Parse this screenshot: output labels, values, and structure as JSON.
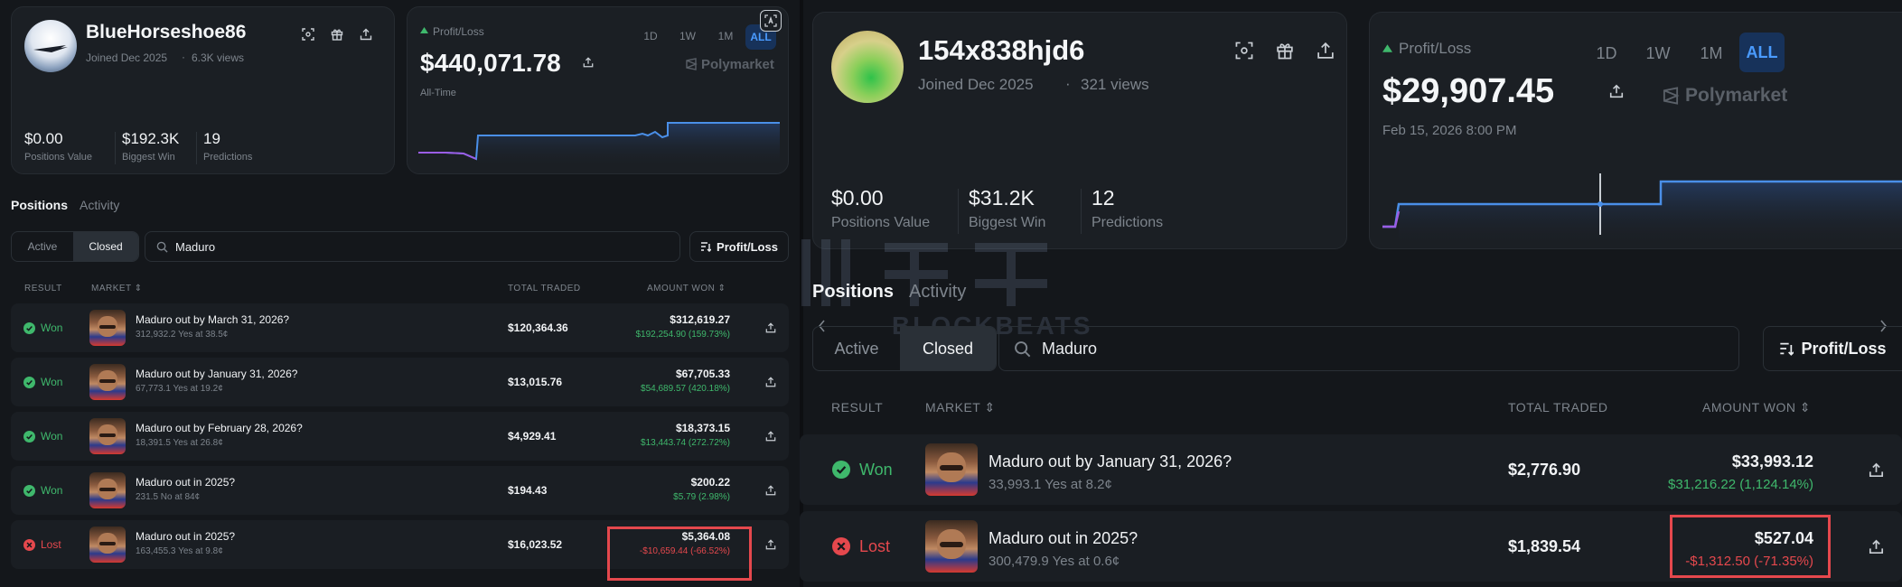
{
  "left": {
    "profile": {
      "username": "BlueHorseshoe86",
      "joined": "Joined Dec 2025",
      "views": "6.3K views",
      "stats": [
        {
          "value": "$0.00",
          "label": "Positions Value"
        },
        {
          "value": "$192.3K",
          "label": "Biggest Win"
        },
        {
          "value": "19",
          "label": "Predictions"
        }
      ]
    },
    "pnl": {
      "label": "Profit/Loss",
      "value": "$440,071.78",
      "sub": "All-Time",
      "brand": "Polymarket",
      "ranges": [
        "1D",
        "1W",
        "1M",
        "ALL"
      ],
      "active_range": "ALL"
    },
    "tabs": [
      "Positions",
      "Activity"
    ],
    "filter": {
      "active": "Active",
      "closed": "Closed"
    },
    "search": {
      "value": "Maduro"
    },
    "sort_label": "Profit/Loss",
    "columns": {
      "result": "RESULT",
      "market": "MARKET",
      "total_traded": "TOTAL TRADED",
      "amount_won": "AMOUNT WON"
    },
    "rows": [
      {
        "result": "Won",
        "market": "Maduro out by March 31, 2026?",
        "detail": "312,932.2 Yes at 38.5¢",
        "total": "$120,364.36",
        "amount": "$312,619.27",
        "pnl": "$192,254.90 (159.73%)"
      },
      {
        "result": "Won",
        "market": "Maduro out by January 31, 2026?",
        "detail": "67,773.1 Yes at 19.2¢",
        "total": "$13,015.76",
        "amount": "$67,705.33",
        "pnl": "$54,689.57 (420.18%)"
      },
      {
        "result": "Won",
        "market": "Maduro out by February 28, 2026?",
        "detail": "18,391.5 Yes at 26.8¢",
        "total": "$4,929.41",
        "amount": "$18,373.15",
        "pnl": "$13,443.74 (272.72%)"
      },
      {
        "result": "Won",
        "market": "Maduro out in 2025?",
        "detail": "231.5 No at 84¢",
        "total": "$194.43",
        "amount": "$200.22",
        "pnl": "$5.79 (2.98%)"
      },
      {
        "result": "Lost",
        "market": "Maduro out in 2025?",
        "detail": "163,455.3 Yes at 9.8¢",
        "total": "$16,023.52",
        "amount": "$5,364.08",
        "pnl": "-$10,659.44 (-66.52%)"
      }
    ]
  },
  "right": {
    "profile": {
      "username": "154x838hjd6",
      "joined": "Joined Dec 2025",
      "views": "321 views",
      "stats": [
        {
          "value": "$0.00",
          "label": "Positions Value"
        },
        {
          "value": "$31.2K",
          "label": "Biggest Win"
        },
        {
          "value": "12",
          "label": "Predictions"
        }
      ]
    },
    "pnl": {
      "label": "Profit/Loss",
      "value": "$29,907.45",
      "sub": "Feb 15, 2026 8:00 PM",
      "brand": "Polymarket",
      "ranges": [
        "1D",
        "1W",
        "1M",
        "ALL"
      ],
      "active_range": "ALL"
    },
    "tabs": [
      "Positions",
      "Activity"
    ],
    "filter": {
      "active": "Active",
      "closed": "Closed"
    },
    "search": {
      "value": "Maduro"
    },
    "sort_label": "Profit/Loss",
    "columns": {
      "result": "RESULT",
      "market": "MARKET",
      "total_traded": "TOTAL TRADED",
      "amount_won": "AMOUNT WON"
    },
    "rows": [
      {
        "result": "Won",
        "market": "Maduro out by January 31, 2026?",
        "detail": "33,993.1 Yes at 8.2¢",
        "total": "$2,776.90",
        "amount": "$33,993.12",
        "pnl": "$31,216.22 (1,124.14%)"
      },
      {
        "result": "Lost",
        "market": "Maduro out in 2025?",
        "detail": "300,479.9 Yes at 0.6¢",
        "total": "$1,839.54",
        "amount": "$527.04",
        "pnl": "-$1,312.50 (-71.35%)"
      }
    ]
  },
  "watermark": {
    "text": "BLOCKBEATS"
  },
  "colors": {
    "won": "#3fb86c",
    "lost": "#e5484d",
    "accent": "#4a9bff",
    "highlight_box": "#e5484d"
  },
  "icons": [
    "scan-icon",
    "gift-icon",
    "share-icon",
    "polymarket-logo-icon",
    "sort-icon",
    "search-icon",
    "check-circle-icon",
    "x-circle-icon",
    "translate-icon",
    "chevron-left-icon",
    "chevron-right-icon"
  ]
}
